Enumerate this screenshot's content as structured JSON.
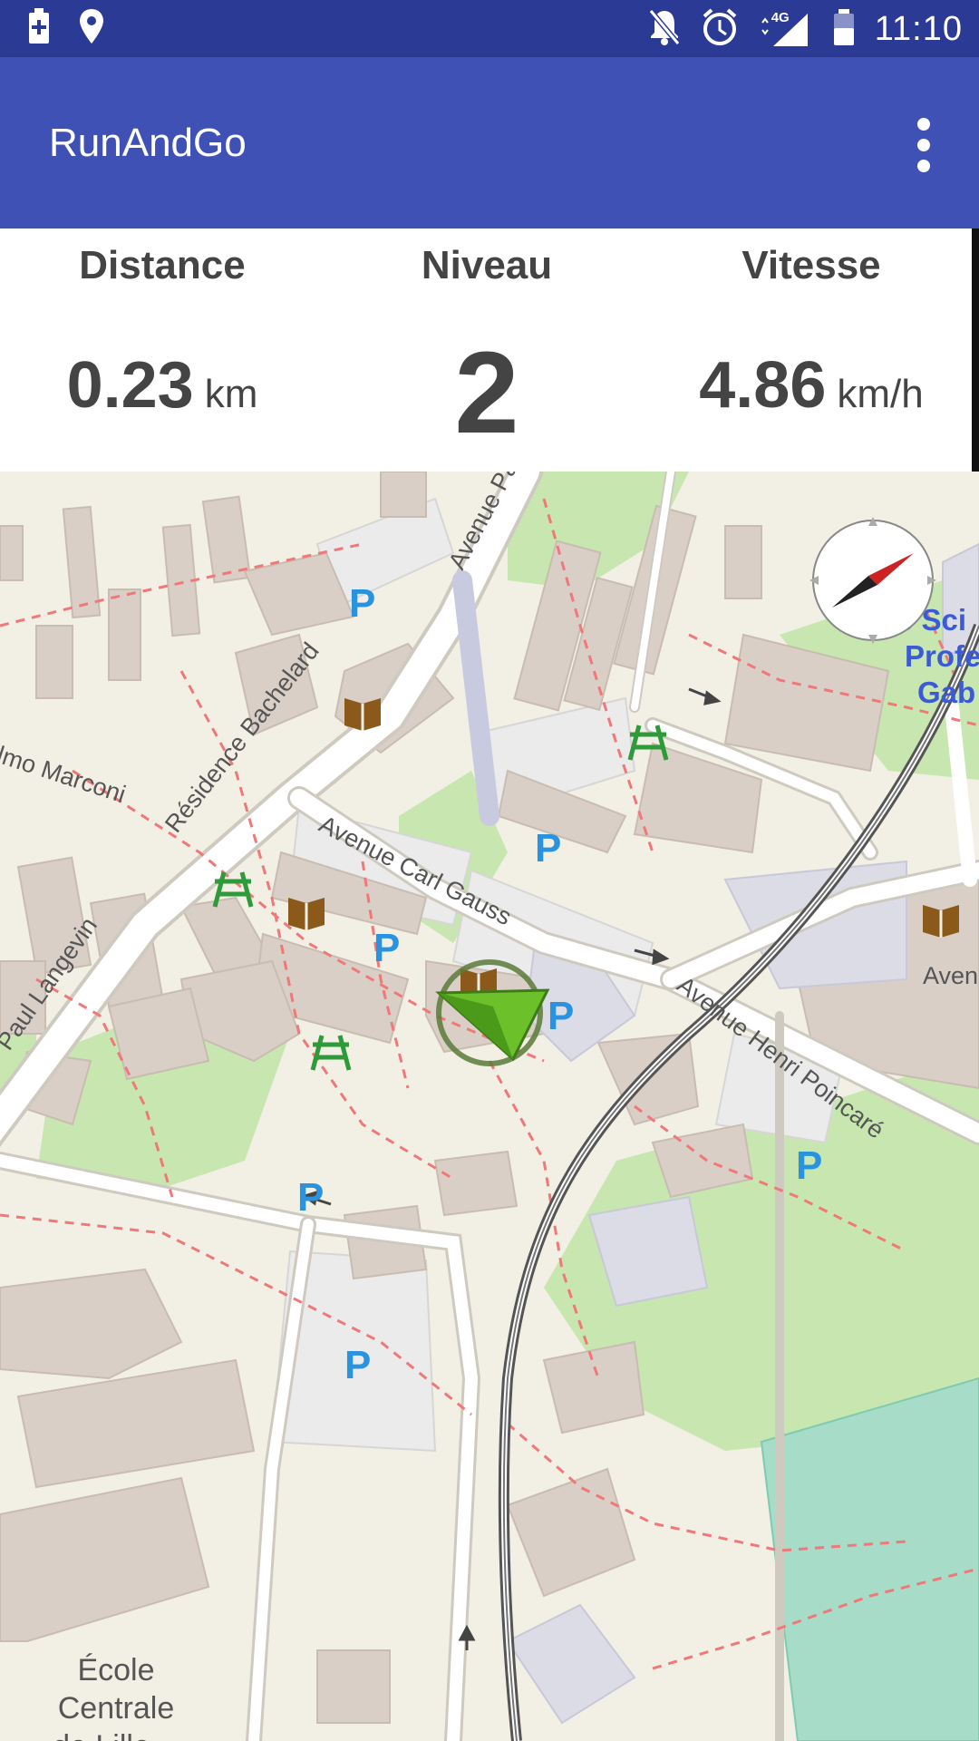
{
  "status_bar": {
    "left_icons": [
      "battery-charging-icon",
      "location-icon"
    ],
    "right_icons": [
      "notifications-off-icon",
      "alarm-icon",
      "signal-4g-icon",
      "battery-icon"
    ],
    "network": "4G",
    "time": "11:10"
  },
  "app_bar": {
    "title": "RunAndGo",
    "menu_icon": "overflow-menu-icon"
  },
  "stats": {
    "distance": {
      "label": "Distance",
      "value": "0.23",
      "unit": "km"
    },
    "level": {
      "label": "Niveau",
      "value": "2"
    },
    "speed": {
      "label": "Vitesse",
      "value": "4.86",
      "unit": "km/h"
    }
  },
  "map": {
    "streets": [
      "Avenue Pau",
      "Résidence Bachelard",
      "lmo Marconi",
      "Paul Langevin",
      "Avenue Carl Gauss",
      "Avenue Henri Poincaré",
      "Aven"
    ],
    "places": [
      "Cité Sci",
      "Profe",
      "Gab",
      "École",
      "Centrale",
      "de Lille"
    ],
    "compass_icon": "compass-icon",
    "location_marker_icon": "position-arrow-icon",
    "colors": {
      "land": "#f2efe4",
      "building": "#d9cfc7",
      "park": "#c8e6b0",
      "parking": "#ebebeb",
      "road": "#ffffff",
      "path": "#f07878",
      "label_blue": "#3b5bd6",
      "parking_letter": "#2a93e0"
    }
  }
}
